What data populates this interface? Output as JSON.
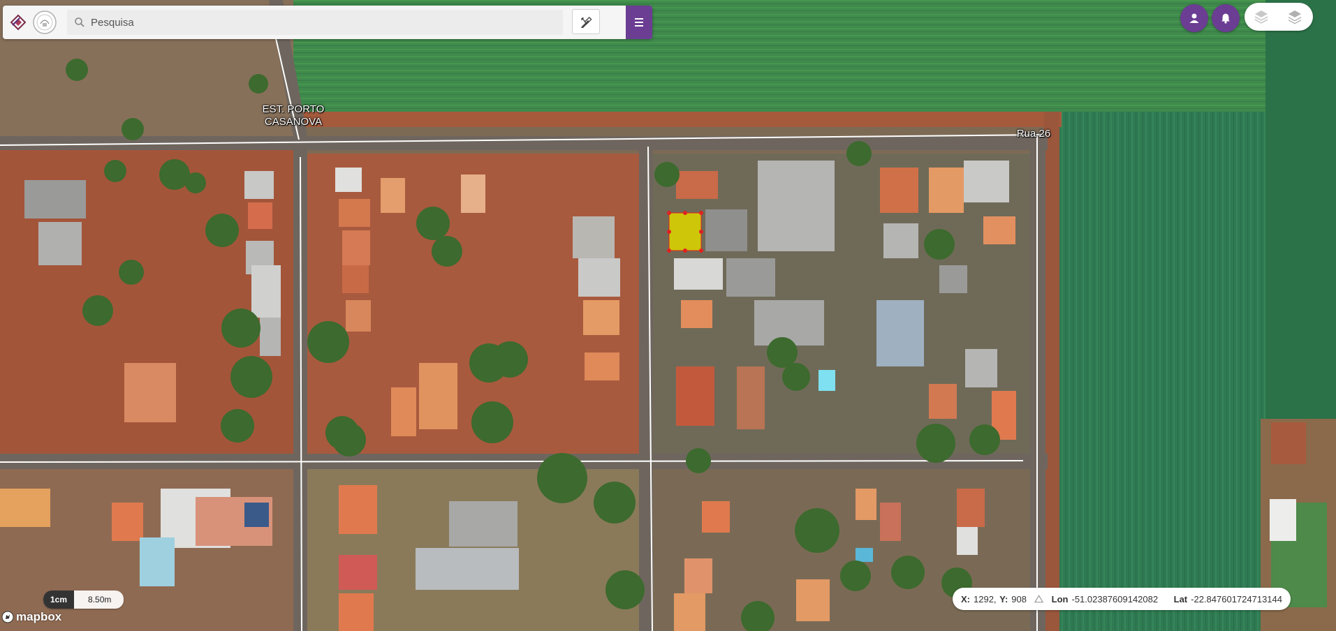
{
  "toolbar": {
    "search_placeholder": "Pesquisa",
    "search_icon": "search-icon",
    "tool_icon": "pencil-ruler-icon",
    "menu_icon": "hamburger-menu-icon",
    "accent_color": "#6b3d93"
  },
  "top_right": {
    "user_icon": "user-icon",
    "bell_icon": "bell-icon",
    "layers_icon": "layers-icon"
  },
  "map": {
    "road_labels": {
      "est_porto_line1": "EST. PORTO",
      "est_porto_line2": "CASANOVA",
      "rua26": "Rua 26"
    },
    "selected_parcel_color": "#d8d000",
    "selected_parcel_vertex_color": "#e02020"
  },
  "scale": {
    "unit": "1cm",
    "value": "8.50m"
  },
  "attribution": {
    "logo_text": "mapbox"
  },
  "coords": {
    "x_label": "X:",
    "x_value": "1292,",
    "y_label": "Y:",
    "y_value": "908",
    "lon_label": "Lon",
    "lon_value": "-51.02387609142082",
    "lat_label": "Lat",
    "lat_value": "-22.847601724713144"
  }
}
